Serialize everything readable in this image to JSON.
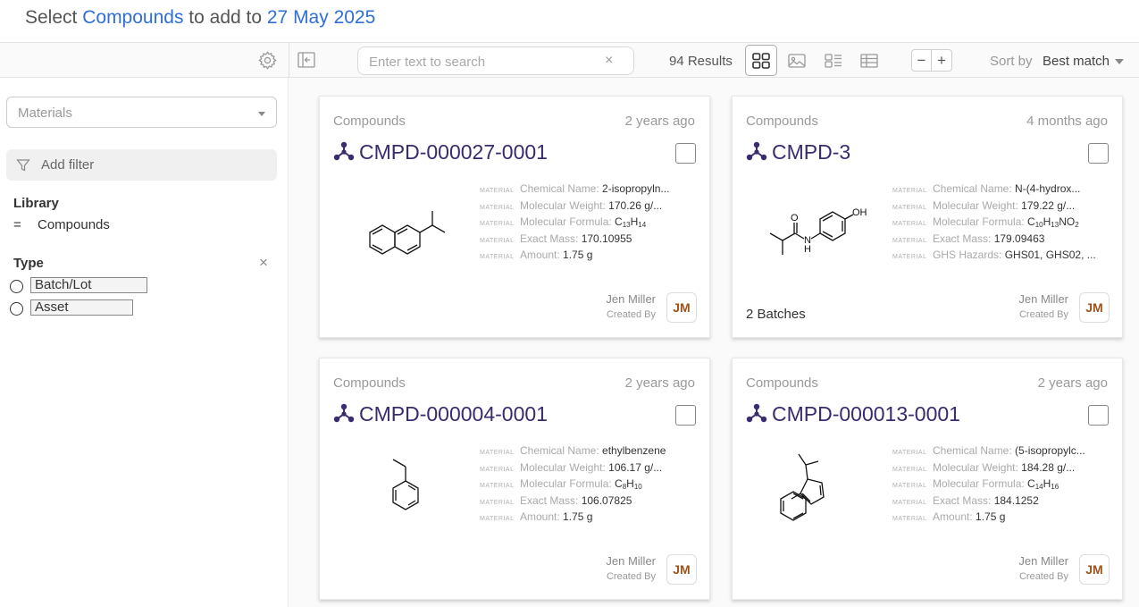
{
  "header": {
    "prefix": "Select",
    "collection": "Compounds",
    "middle": "to add to",
    "target": "27 May 2025"
  },
  "toolbar": {
    "search_placeholder": "Enter text to search",
    "clear_glyph": "×",
    "results_count": "94 Results",
    "zoom_out": "−",
    "zoom_in": "+",
    "sort_label": "Sort by",
    "sort_value": "Best match",
    "active_view": "grid"
  },
  "sidebar": {
    "materials_placeholder": "Materials",
    "add_filter": "Add filter",
    "library_title": "Library",
    "library_operator": "=",
    "library_value": "Compounds",
    "type_title": "Type",
    "type_close": "×",
    "type_options": [
      "Batch/Lot",
      "Asset"
    ]
  },
  "cards": [
    {
      "library": "Compounds",
      "time": "2 years ago",
      "id": "CMPD-000027-0001",
      "properties": [
        {
          "tag": "MATERIAL",
          "name": "Chemical Name:",
          "value": "2-isopropyln..."
        },
        {
          "tag": "MATERIAL",
          "name": "Molecular Weight:",
          "value": "170.26 g/..."
        },
        {
          "tag": "MATERIAL",
          "name": "Molecular Formula:",
          "formula": [
            [
              "C",
              "13"
            ],
            [
              "H",
              "14"
            ]
          ]
        },
        {
          "tag": "MATERIAL",
          "name": "Exact Mass:",
          "value": "170.10955"
        },
        {
          "tag": "MATERIAL",
          "name": "Amount:",
          "value": "1.75 g"
        }
      ],
      "extra": "",
      "creator": "Jen Miller",
      "created_by_label": "Created By",
      "initials": "JM",
      "structure": "naphthalene-isopropyl"
    },
    {
      "library": "Compounds",
      "time": "4 months ago",
      "id": "CMPD-3",
      "properties": [
        {
          "tag": "MATERIAL",
          "name": "Chemical Name:",
          "value": "N-(4-hydrox..."
        },
        {
          "tag": "MATERIAL",
          "name": "Molecular Weight:",
          "value": "179.22 g/..."
        },
        {
          "tag": "MATERIAL",
          "name": "Molecular Formula:",
          "formula": [
            [
              "C",
              "10"
            ],
            [
              "H",
              "13"
            ],
            [
              "NO",
              "2"
            ]
          ]
        },
        {
          "tag": "MATERIAL",
          "name": "Exact Mass:",
          "value": "179.09463"
        },
        {
          "tag": "MATERIAL",
          "name": "GHS Hazards:",
          "value": "GHS01, GHS02, ..."
        }
      ],
      "extra": "2 Batches",
      "creator": "Jen Miller",
      "created_by_label": "Created By",
      "initials": "JM",
      "structure": "hydroxyphenyl-amide",
      "structure_labels": {
        "oh": "OH",
        "o": "O",
        "n": "N",
        "h": "H"
      }
    },
    {
      "library": "Compounds",
      "time": "2 years ago",
      "id": "CMPD-000004-0001",
      "properties": [
        {
          "tag": "MATERIAL",
          "name": "Chemical Name:",
          "value": "ethylbenzene"
        },
        {
          "tag": "MATERIAL",
          "name": "Molecular Weight:",
          "value": "106.17 g/..."
        },
        {
          "tag": "MATERIAL",
          "name": "Molecular Formula:",
          "formula": [
            [
              "C",
              "8"
            ],
            [
              "H",
              "10"
            ]
          ]
        },
        {
          "tag": "MATERIAL",
          "name": "Exact Mass:",
          "value": "106.07825"
        },
        {
          "tag": "MATERIAL",
          "name": "Amount:",
          "value": "1.75 g"
        }
      ],
      "extra": "",
      "creator": "Jen Miller",
      "created_by_label": "Created By",
      "initials": "JM",
      "structure": "ethylbenzene"
    },
    {
      "library": "Compounds",
      "time": "2 years ago",
      "id": "CMPD-000013-0001",
      "properties": [
        {
          "tag": "MATERIAL",
          "name": "Chemical Name:",
          "value": "(5-isopropylc..."
        },
        {
          "tag": "MATERIAL",
          "name": "Molecular Weight:",
          "value": "184.28 g/..."
        },
        {
          "tag": "MATERIAL",
          "name": "Molecular Formula:",
          "formula": [
            [
              "C",
              "14"
            ],
            [
              "H",
              "16"
            ]
          ]
        },
        {
          "tag": "MATERIAL",
          "name": "Exact Mass:",
          "value": "184.1252"
        },
        {
          "tag": "MATERIAL",
          "name": "Amount:",
          "value": "1.75 g"
        }
      ],
      "extra": "",
      "creator": "Jen Miller",
      "created_by_label": "Created By",
      "initials": "JM",
      "structure": "phenyl-isopropyl-cyclopentadiene"
    }
  ]
}
